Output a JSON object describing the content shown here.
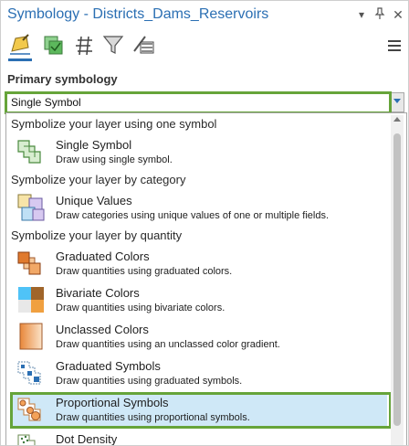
{
  "window": {
    "title": "Symbology - Districts_Dams_Reservoirs",
    "controls": [
      "chevron-down-icon",
      "pin-icon",
      "close-icon"
    ]
  },
  "toolbar": {
    "icons": [
      "primary-symbology-icon",
      "vary-symbology-icon",
      "symbol-classes-icon",
      "filter-icon",
      "label-classes-icon"
    ],
    "active": "primary-symbology-icon",
    "menu_icon": "hamburger-icon"
  },
  "primary": {
    "label": "Primary symbology",
    "selected": "Single Symbol"
  },
  "groups": [
    {
      "header": "Symbolize your layer using one symbol"
    },
    {
      "header": "Symbolize your layer by category"
    },
    {
      "header": "Symbolize your layer by quantity"
    }
  ],
  "items": [
    {
      "title": "Single Symbol",
      "desc": "Draw using single symbol.",
      "icon": "single-symbol-icon"
    },
    {
      "title": "Unique Values",
      "desc": "Draw categories using unique values of one or multiple fields.",
      "icon": "unique-values-icon"
    },
    {
      "title": "Graduated Colors",
      "desc": "Draw quantities using graduated colors.",
      "icon": "graduated-colors-icon"
    },
    {
      "title": "Bivariate Colors",
      "desc": "Draw quantities using bivariate colors.",
      "icon": "bivariate-colors-icon"
    },
    {
      "title": "Unclassed Colors",
      "desc": "Draw quantities using an unclassed color gradient.",
      "icon": "unclassed-colors-icon"
    },
    {
      "title": "Graduated Symbols",
      "desc": "Draw quantities using graduated symbols.",
      "icon": "graduated-symbols-icon"
    },
    {
      "title": "Proportional Symbols",
      "desc": "Draw quantities using proportional symbols.",
      "icon": "proportional-symbols-icon"
    },
    {
      "title": "Dot Density",
      "desc": "",
      "icon": "dot-density-icon"
    }
  ],
  "colors": {
    "title": "#2b6fb3",
    "highlight": "#66a43a",
    "selected_row": "#cfe8f7"
  }
}
